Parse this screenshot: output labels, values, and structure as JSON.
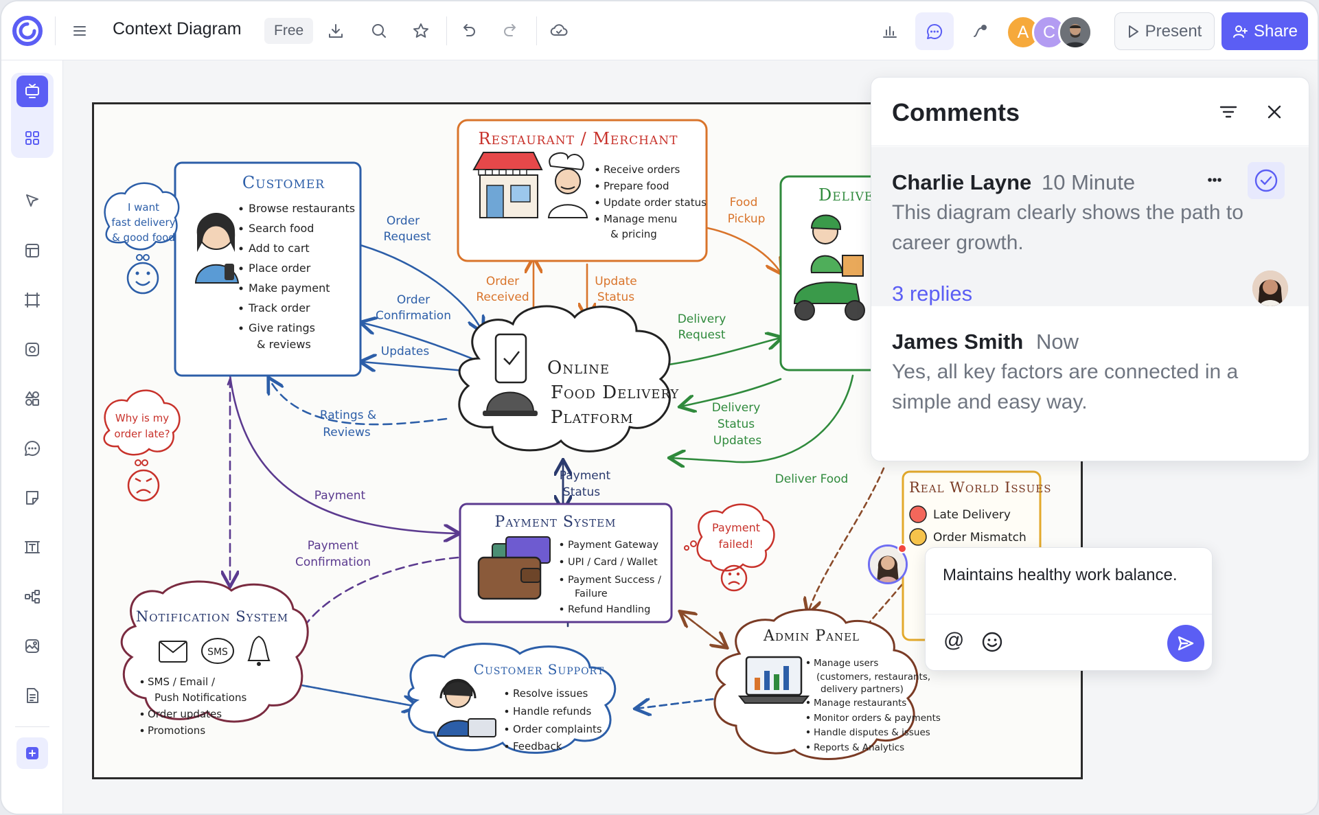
{
  "header": {
    "doc_title": "Context Diagram",
    "plan_badge": "Free",
    "collaborators": [
      {
        "initial": "A",
        "color": "#f6a93b"
      },
      {
        "initial": "C",
        "color": "#b39cf2"
      },
      {
        "initial": "",
        "color": "#555a60"
      }
    ],
    "present_label": "Present",
    "share_label": "Share",
    "accent_color": "#5b5ef4"
  },
  "diagram": {
    "customer": {
      "title": "Customer",
      "items": [
        "Browse restaurants",
        "Search food",
        "Add to cart",
        "Place order",
        "Make payment",
        "Track order",
        "Give ratings",
        "& reviews"
      ]
    },
    "restaurant": {
      "title": "Restaurant / Merchant",
      "items": [
        "Receive orders",
        "Prepare food",
        "Update order status",
        "Manage menu",
        "& pricing"
      ]
    },
    "delivery": {
      "title": "Deliver"
    },
    "platform": {
      "line1": "Online",
      "line2": "Food Delivery",
      "line3": "Platform"
    },
    "payment": {
      "title": "Payment System",
      "items": [
        "Payment Gateway",
        "UPI / Card / Wallet",
        "Payment Success /",
        "Failure",
        "Refund Handling"
      ]
    },
    "notification": {
      "title": "Notification System",
      "sms_badge": "SMS",
      "items": [
        "SMS / Email /",
        "Push Notifications",
        "Order updates",
        "Promotions"
      ]
    },
    "support": {
      "title": "Customer Support",
      "items": [
        "Resolve issues",
        "Handle refunds",
        "Order complaints",
        "Feedback"
      ]
    },
    "admin": {
      "title": "Admin Panel",
      "items": [
        "Manage users",
        "(customers, restaurants,",
        "delivery partners)",
        "Manage restaurants",
        "Monitor orders & payments",
        "Handle disputes & issues",
        "Reports & Analytics"
      ]
    },
    "issues": {
      "title": "Real World Issues",
      "items": [
        "Late Delivery",
        "Order Mismatch"
      ]
    },
    "bubbles": {
      "want": [
        "I want",
        "fast delivery",
        "& good food"
      ],
      "late": [
        "Why is my",
        "order late?"
      ],
      "failed": [
        "Payment",
        "failed!"
      ]
    },
    "arrows": {
      "order_request": [
        "Order",
        "Request"
      ],
      "order_confirmation": [
        "Order",
        "Confirmation"
      ],
      "updates": "Updates",
      "ratings": [
        "Ratings &",
        "Reviews"
      ],
      "order_received": [
        "Order",
        "Received"
      ],
      "update_status": [
        "Update",
        "Status"
      ],
      "food_pickup": [
        "Food",
        "Pickup"
      ],
      "delivery_request": [
        "Delivery",
        "Request"
      ],
      "delivery_status": [
        "Delivery",
        "Status",
        "Updates"
      ],
      "deliver_food": "Deliver Food",
      "payment": "Payment",
      "payment_confirmation": [
        "Payment",
        "Confirmation"
      ],
      "payment_status": [
        "Payment",
        "Status"
      ]
    }
  },
  "comments_panel": {
    "title": "Comments",
    "comments": [
      {
        "author": "Charlie Layne",
        "time": "10 Minute",
        "body": "This diagram clearly shows the path to career growth.",
        "replies": "3 replies"
      },
      {
        "author": "James Smith",
        "time": "Now",
        "body": "Yes, all key factors are connected in a simple and easy way."
      }
    ]
  },
  "composer": {
    "value": "Maintains healthy work balance.",
    "mention_symbol": "@"
  }
}
